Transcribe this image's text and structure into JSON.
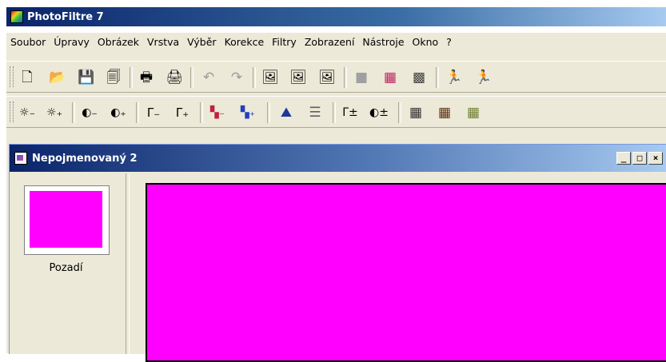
{
  "app": {
    "title": "PhotoFiltre 7"
  },
  "menu": [
    "Soubor",
    "Úpravy",
    "Obrázek",
    "Vrstva",
    "Výběr",
    "Korekce",
    "Filtry",
    "Zobrazení",
    "Nástroje",
    "Okno",
    "?"
  ],
  "toolbar1": {
    "buttons": [
      {
        "name": "new-icon",
        "glyph": "🗋",
        "color": "#222222"
      },
      {
        "name": "open-icon",
        "glyph": "📂",
        "color": "#c8a000"
      },
      {
        "name": "save-icon",
        "glyph": "💾",
        "color": "#204080"
      },
      {
        "name": "save-as-icon",
        "glyph": "🗐",
        "color": "#204080"
      },
      {
        "name": "print-icon",
        "glyph": "🖶",
        "color": "#303030"
      },
      {
        "name": "scan-icon",
        "glyph": "🖨",
        "color": "#303030"
      },
      {
        "name": "undo-icon",
        "glyph": "↶",
        "color": "#9a9a9a"
      },
      {
        "name": "redo-icon",
        "glyph": "↷",
        "color": "#9a9a9a"
      },
      {
        "name": "image-size-icon",
        "glyph": "🖼",
        "color": "#3a7a30"
      },
      {
        "name": "canvas-size-icon",
        "glyph": "🖼",
        "color": "#5a6a80"
      },
      {
        "name": "fit-image-icon",
        "glyph": "🖼",
        "color": "#3a7a30"
      },
      {
        "name": "gray-square-icon",
        "glyph": "■",
        "color": "#a0a0a0"
      },
      {
        "name": "color-palette-icon",
        "glyph": "▦",
        "color": "#c02060"
      },
      {
        "name": "gallery-icon",
        "glyph": "▩",
        "color": "#404040"
      },
      {
        "name": "manual-icon",
        "glyph": "🏃",
        "color": "#303030"
      },
      {
        "name": "automate-icon",
        "glyph": "🏃",
        "color": "#a03000"
      }
    ]
  },
  "toolbar2": {
    "buttons": [
      {
        "name": "brightness-minus-icon",
        "glyph": "☼₋"
      },
      {
        "name": "brightness-plus-icon",
        "glyph": "☼₊"
      },
      {
        "name": "contrast-minus-icon",
        "glyph": "◐₋"
      },
      {
        "name": "contrast-plus-icon",
        "glyph": "◐₊"
      },
      {
        "name": "gamma-minus-icon",
        "glyph": "Γ₋"
      },
      {
        "name": "gamma-plus-icon",
        "glyph": "Γ₊"
      },
      {
        "name": "saturation-minus-icon",
        "glyph": "▚₋"
      },
      {
        "name": "saturation-plus-icon",
        "glyph": "▚₊"
      },
      {
        "name": "levels-icon",
        "glyph": "⛰"
      },
      {
        "name": "adjust-icon",
        "glyph": "☰"
      },
      {
        "name": "auto-gamma-icon",
        "glyph": "Γ±"
      },
      {
        "name": "auto-contrast-icon",
        "glyph": "◐±"
      },
      {
        "name": "grid-dark-icon",
        "glyph": "▦"
      },
      {
        "name": "grid-brown-icon",
        "glyph": "▦"
      },
      {
        "name": "grid-olive-icon",
        "glyph": "▦"
      }
    ]
  },
  "document": {
    "title": "Nepojmenovaný 2",
    "controls": [
      "_",
      "□",
      "×"
    ],
    "layer_label": "Pozadí",
    "fill_color": "#ff00ff"
  }
}
